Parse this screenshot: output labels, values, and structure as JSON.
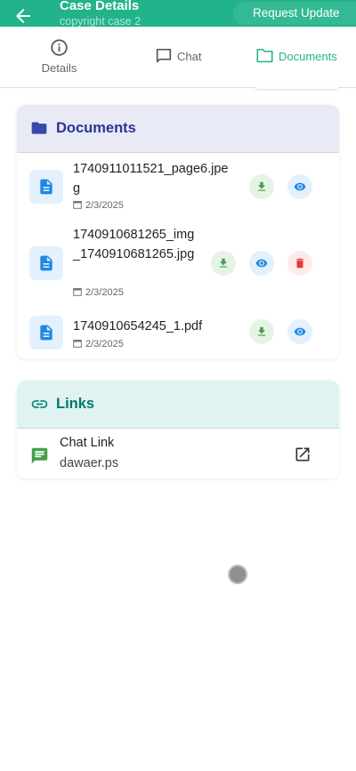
{
  "header": {
    "title": "Case Details",
    "subtitle": "copyright case 2",
    "request_button": "Request Update",
    "back_icon": "arrow-left-icon"
  },
  "tabs": [
    {
      "label": "Details",
      "icon": "info-icon",
      "active": false
    },
    {
      "label": "Chat",
      "icon": "chat-icon",
      "active": false
    },
    {
      "label": "Documents",
      "icon": "folder-icon",
      "active": true
    }
  ],
  "documents": {
    "title": "Documents",
    "items": [
      {
        "name": "1740911011521_page6.jpeg",
        "date": "2/3/2025",
        "actions": [
          "download",
          "view"
        ]
      },
      {
        "name": "1740910681265_img_1740910681265.jpg",
        "date": "2/3/2025",
        "actions": [
          "download",
          "view",
          "delete"
        ]
      },
      {
        "name": "1740910654245_1.pdf",
        "date": "2/3/2025",
        "actions": [
          "download",
          "view"
        ]
      }
    ]
  },
  "links": {
    "title": "Links",
    "items": [
      {
        "title": "Chat Link",
        "url": "dawaer.ps"
      }
    ]
  },
  "colors": {
    "primary": "#22b38a",
    "documents_header_bg": "#e8eaf6",
    "documents_title": "#283593",
    "links_header_bg": "#e0f2f1",
    "links_title": "#00796b",
    "download": "#43a047",
    "view": "#1e88e5",
    "delete": "#e53935"
  }
}
